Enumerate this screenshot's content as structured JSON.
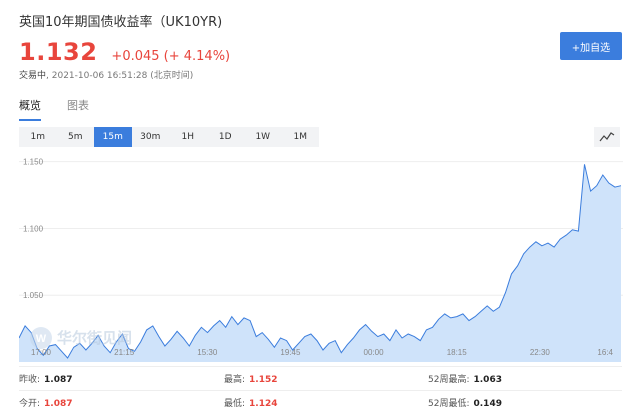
{
  "quote": {
    "title": "英国10年期国债收益率（UK10YR)",
    "price": "1.132",
    "change": "+0.045 (+ 4.14%)",
    "status": "交易中",
    "timestamp": "2021-10-06 16:51:28 (北京时间)",
    "add_watchlist": "+加自选",
    "price_color": "#e8453c",
    "accent_color": "#3b7ddd"
  },
  "tabs": [
    {
      "label": "概览",
      "active": true
    },
    {
      "label": "图表",
      "active": false
    }
  ],
  "ranges": [
    {
      "label": "1m",
      "active": false
    },
    {
      "label": "5m",
      "active": false
    },
    {
      "label": "15m",
      "active": true
    },
    {
      "label": "30m",
      "active": false
    },
    {
      "label": "1H",
      "active": false
    },
    {
      "label": "1D",
      "active": false
    },
    {
      "label": "1W",
      "active": false
    },
    {
      "label": "1M",
      "active": false
    }
  ],
  "chart_type_icon": "line-chart-icon",
  "watermark": "华尔街见闻",
  "chart_data": {
    "type": "area",
    "x_tick_labels": [
      "17:00",
      "21:15",
      "15:30",
      "19:45",
      "00:00",
      "18:15",
      "22:30",
      "16:4"
    ],
    "y_tick_labels": [
      "1.150",
      "1.100",
      "1.050"
    ],
    "ylim": [
      1.0,
      1.155
    ],
    "grid": true,
    "series_color": "#3b7ddd",
    "fill_color": "#cfe3fa",
    "values": [
      1.018,
      1.027,
      1.022,
      1.01,
      1.005,
      1.012,
      1.013,
      1.008,
      1.003,
      1.011,
      1.014,
      1.009,
      1.014,
      1.02,
      1.012,
      1.007,
      1.015,
      1.021,
      1.01,
      1.008,
      1.015,
      1.024,
      1.027,
      1.019,
      1.012,
      1.017,
      1.023,
      1.018,
      1.012,
      1.02,
      1.026,
      1.022,
      1.027,
      1.031,
      1.026,
      1.034,
      1.028,
      1.033,
      1.031,
      1.019,
      1.022,
      1.017,
      1.011,
      1.018,
      1.016,
      1.009,
      1.014,
      1.019,
      1.021,
      1.016,
      1.009,
      1.014,
      1.016,
      1.007,
      1.013,
      1.018,
      1.024,
      1.028,
      1.023,
      1.019,
      1.021,
      1.016,
      1.024,
      1.018,
      1.021,
      1.019,
      1.016,
      1.024,
      1.026,
      1.032,
      1.036,
      1.033,
      1.034,
      1.036,
      1.031,
      1.034,
      1.038,
      1.042,
      1.038,
      1.041,
      1.052,
      1.066,
      1.072,
      1.081,
      1.086,
      1.09,
      1.087,
      1.089,
      1.086,
      1.092,
      1.095,
      1.099,
      1.098,
      1.148,
      1.128,
      1.132,
      1.14,
      1.134,
      1.131,
      1.132
    ]
  },
  "stats": {
    "prev_close_label": "昨收:",
    "prev_close": "1.087",
    "open_label": "今开:",
    "open": "1.087",
    "high_label": "最高:",
    "high": "1.152",
    "low_label": "最低:",
    "low": "1.124",
    "w52_high_label": "52周最高:",
    "w52_high": "1.063",
    "w52_low_label": "52周最低:",
    "w52_low": "0.149"
  }
}
